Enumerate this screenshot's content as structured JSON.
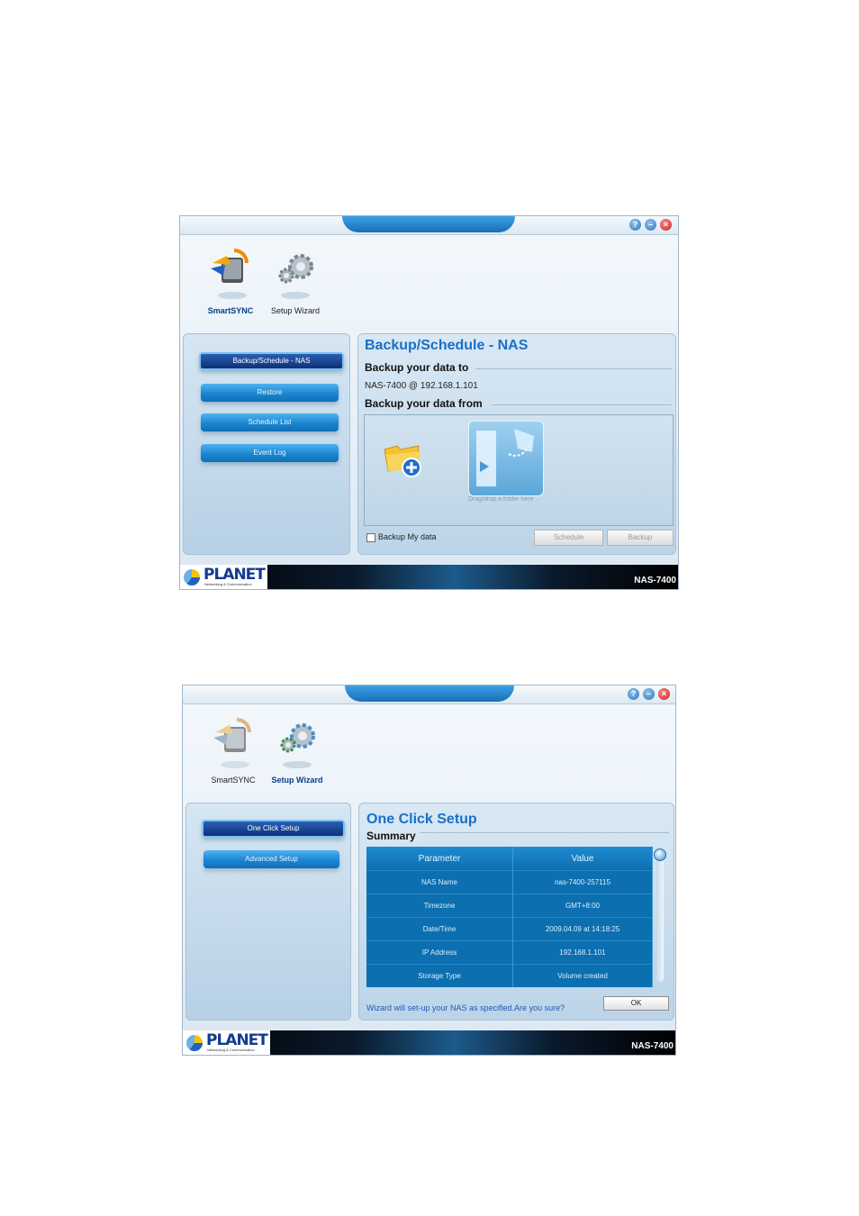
{
  "window1": {
    "title_controls": [
      "?",
      "–",
      "×"
    ],
    "apps": [
      {
        "label": "SmartSYNC",
        "icon": "smartsync-icon",
        "active": true
      },
      {
        "label": "Setup Wizard",
        "icon": "gear-icon",
        "active": false
      }
    ],
    "nav": [
      "Backup/Schedule - NAS",
      "Restore",
      "Schedule List",
      "Event Log"
    ],
    "panel_title": "Backup/Schedule - NAS",
    "section_to": "Backup your data to",
    "target": "NAS-7400 @ 192.168.1.101",
    "section_from": "Backup your data from",
    "drop_hint": "Drag/drop a folder here",
    "checkbox_label": "Backup My data",
    "schedule_btn": "Schedule",
    "backup_btn": "Backup",
    "brand": "PLANET",
    "brand_tag": "Networking & Communication",
    "model": "NAS-7400"
  },
  "window2": {
    "title_controls": [
      "?",
      "–",
      "×"
    ],
    "apps": [
      {
        "label": "SmartSYNC",
        "icon": "smartsync-icon",
        "active": false
      },
      {
        "label": "Setup Wizard",
        "icon": "gear-icon",
        "active": true
      }
    ],
    "nav": [
      "One Click Setup",
      "Advanced Setup"
    ],
    "panel_title": "One Click Setup",
    "section": "Summary",
    "table": {
      "headers": [
        "Parameter",
        "Value"
      ],
      "rows": [
        [
          "NAS Name",
          "nas-7400-257115"
        ],
        [
          "Timezone",
          "GMT+8:00"
        ],
        [
          "Date/Time",
          "2009.04.09 at 14:18:25"
        ],
        [
          "IP Address",
          "192.168.1.101"
        ],
        [
          "Storage Type",
          "Volume created"
        ]
      ]
    },
    "confirm_text": "Wizard will set-up your NAS as specified.Are you sure?",
    "ok_btn": "OK",
    "brand": "PLANET",
    "brand_tag": "Networking & Communication",
    "model": "NAS-7400"
  },
  "colors": {
    "accent": "#1a6fc8",
    "nav_button": "#1a86d0",
    "table_bg": "#0c6fb0"
  }
}
